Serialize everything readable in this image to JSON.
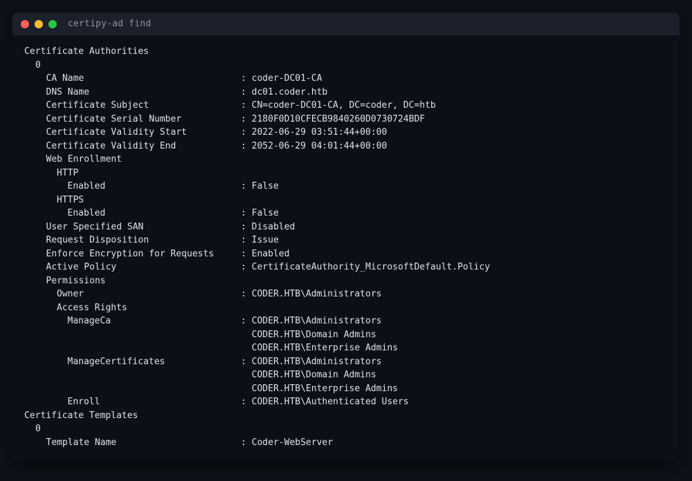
{
  "window": {
    "title": "certipy-ad find",
    "controls": {
      "close_color": "#ff5f57",
      "minimize_color": "#febc2e",
      "maximize_color": "#28c840"
    }
  },
  "terminal": {
    "lines": [
      {
        "indent": 0,
        "key": "Certificate Authorities",
        "value": ""
      },
      {
        "indent": 1,
        "key": "0",
        "value": ""
      },
      {
        "indent": 2,
        "key": "CA Name",
        "value": ": coder-DC01-CA"
      },
      {
        "indent": 2,
        "key": "DNS Name",
        "value": ": dc01.coder.htb"
      },
      {
        "indent": 2,
        "key": "Certificate Subject",
        "value": ": CN=coder-DC01-CA, DC=coder, DC=htb"
      },
      {
        "indent": 2,
        "key": "Certificate Serial Number",
        "value": ": 2180F0D10CFECB9840260D0730724BDF"
      },
      {
        "indent": 2,
        "key": "Certificate Validity Start",
        "value": ": 2022-06-29 03:51:44+00:00"
      },
      {
        "indent": 2,
        "key": "Certificate Validity End",
        "value": ": 2052-06-29 04:01:44+00:00"
      },
      {
        "indent": 2,
        "key": "Web Enrollment",
        "value": ""
      },
      {
        "indent": 3,
        "key": "HTTP",
        "value": ""
      },
      {
        "indent": 4,
        "key": "Enabled",
        "value": ": False"
      },
      {
        "indent": 3,
        "key": "HTTPS",
        "value": ""
      },
      {
        "indent": 4,
        "key": "Enabled",
        "value": ": False"
      },
      {
        "indent": 2,
        "key": "User Specified SAN",
        "value": ": Disabled"
      },
      {
        "indent": 2,
        "key": "Request Disposition",
        "value": ": Issue"
      },
      {
        "indent": 2,
        "key": "Enforce Encryption for Requests",
        "value": ": Enabled"
      },
      {
        "indent": 2,
        "key": "Active Policy",
        "value": ": CertificateAuthority_MicrosoftDefault.Policy"
      },
      {
        "indent": 2,
        "key": "Permissions",
        "value": ""
      },
      {
        "indent": 3,
        "key": "Owner",
        "value": ": CODER.HTB\\Administrators"
      },
      {
        "indent": 3,
        "key": "Access Rights",
        "value": ""
      },
      {
        "indent": 4,
        "key": "ManageCa",
        "value": ": CODER.HTB\\Administrators"
      },
      {
        "indent": 4,
        "key": "",
        "value": "  CODER.HTB\\Domain Admins"
      },
      {
        "indent": 4,
        "key": "",
        "value": "  CODER.HTB\\Enterprise Admins"
      },
      {
        "indent": 4,
        "key": "ManageCertificates",
        "value": ": CODER.HTB\\Administrators"
      },
      {
        "indent": 4,
        "key": "",
        "value": "  CODER.HTB\\Domain Admins"
      },
      {
        "indent": 4,
        "key": "",
        "value": "  CODER.HTB\\Enterprise Admins"
      },
      {
        "indent": 4,
        "key": "Enroll",
        "value": ": CODER.HTB\\Authenticated Users"
      },
      {
        "indent": 0,
        "key": "Certificate Templates",
        "value": ""
      },
      {
        "indent": 1,
        "key": "0",
        "value": ""
      },
      {
        "indent": 2,
        "key": "Template Name",
        "value": ": Coder-WebServer"
      }
    ]
  }
}
